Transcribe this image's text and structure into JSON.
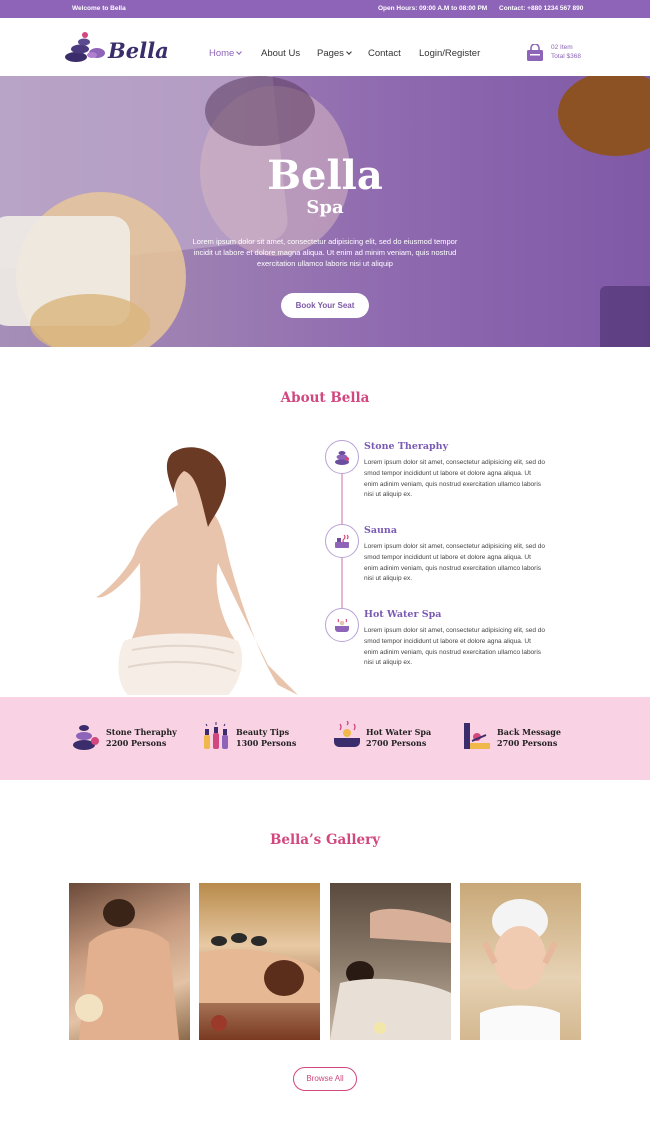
{
  "topbar": {
    "welcome": "Welcome to Bella",
    "hours": "Open Hours: 09:00 A.M to 08:00 PM",
    "contact": "Contact: +880 1234 567 890"
  },
  "header": {
    "logo_text": "Bella",
    "nav": [
      {
        "label": "Home",
        "dropdown": true,
        "active": true
      },
      {
        "label": "About Us",
        "dropdown": false,
        "active": false
      },
      {
        "label": "Pages",
        "dropdown": true,
        "active": false
      },
      {
        "label": "Contact",
        "dropdown": false,
        "active": false
      },
      {
        "label": "Login/Register",
        "dropdown": false,
        "active": false
      }
    ],
    "cart": {
      "items": "02 Item",
      "total": "Total $368",
      "icon": "shopping-bag-icon"
    }
  },
  "hero": {
    "title": "Bella",
    "subtitle": "Spa",
    "text": "Lorem ipsum dolor sit amet, consectetur adipisicing elit, sed do eiusmod tempor incidit ut labore et dolore magna aliqua. Ut enim ad minim veniam, quis nostrud exercitation ullamco laboris nisi ut aliquip",
    "button": "Book Your Seat"
  },
  "about": {
    "title": "About Bella",
    "items": [
      {
        "title": "Stone Theraphy",
        "icon": "stones-icon",
        "text": "Lorem ipsum dolor sit amet, consectetur adipisicing elit, sed do smod tempor incididunt ut labore et dolore agna aliqua. Ut enim adinim veniam, quis nostrud exercitation ullamco laboris nisi ut aliquip ex."
      },
      {
        "title": "Sauna",
        "icon": "sauna-icon",
        "text": "Lorem ipsum dolor sit amet, consectetur adipisicing elit, sed do smod tempor incididunt ut labore et dolore agna aliqua. Ut enim adinim veniam, quis nostrud exercitation ullamco laboris nisi ut aliquip ex."
      },
      {
        "title": "Hot Water Spa",
        "icon": "hot-water-spa-icon",
        "text": "Lorem ipsum dolor sit amet, consectetur adipisicing elit, sed do smod tempor incididunt ut labore et dolore agna aliqua. Ut enim adinim veniam, quis nostrud exercitation ullamco laboris nisi ut aliquip ex."
      }
    ]
  },
  "stats": [
    {
      "title": "Stone Theraphy",
      "count": "2200 Persons",
      "icon": "stones-icon"
    },
    {
      "title": "Beauty Tips",
      "count": "1300 Persons",
      "icon": "nail-polish-icon"
    },
    {
      "title": "Hot Water Spa",
      "count": "2700 Persons",
      "icon": "hot-water-spa-icon"
    },
    {
      "title": "Back Message",
      "count": "2700 Persons",
      "icon": "massage-table-icon"
    }
  ],
  "gallery": {
    "title": "Bella’s Gallery",
    "button": "Browse All"
  },
  "colors": {
    "primary": "#8d64b8",
    "accent": "#d1477e",
    "pink_band": "#f9d2e4",
    "dark": "#3b2d6b"
  }
}
